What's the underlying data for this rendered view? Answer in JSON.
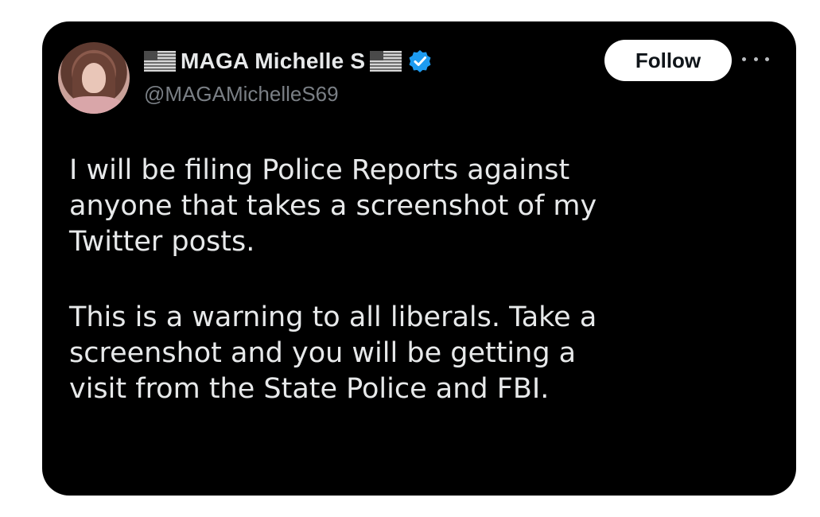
{
  "post": {
    "author": {
      "display_name": "MAGA Michelle S",
      "handle": "@MAGAMichelleS69",
      "verified": true,
      "flag_icon": "us-flag-icon",
      "badge_icon": "verified-badge-icon"
    },
    "actions": {
      "follow_label": "Follow",
      "more_icon": "more-options-icon"
    },
    "text": {
      "paragraph_1": "I will be filing Police Reports against\nanyone that takes a screenshot of my\nTwitter posts.",
      "paragraph_2": "This is a warning to all liberals. Take a\nscreenshot and you will be getting a\nvisit from the State Police and FBI."
    }
  },
  "colors": {
    "background": "#000000",
    "text_primary": "#e7e9ea",
    "text_secondary": "#7a7f85",
    "verified_blue": "#1d9bf0",
    "follow_bg": "#ffffff"
  }
}
